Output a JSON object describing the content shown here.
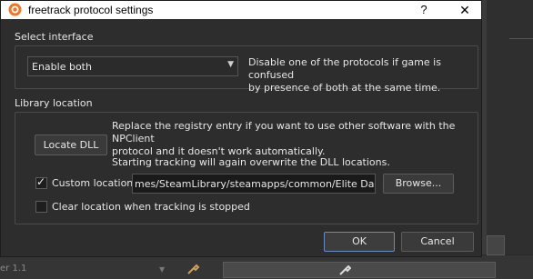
{
  "window": {
    "title": "freetrack protocol settings",
    "help_label": "?",
    "close_label": "✕"
  },
  "interface": {
    "group_label": "Select interface",
    "selected": "Enable both",
    "description_line1": "Disable one of the protocols if game is confused",
    "description_line2": "by presence of both at the same time."
  },
  "library": {
    "group_label": "Library location",
    "locate_button": "Locate DLL",
    "info_line1": "Replace the registry entry if you want to use other software with the NPClient",
    "info_line2": "protocol and it doesn't work automatically.",
    "info_line3": "Starting tracking will again overwrite the DLL locations.",
    "custom_location_label": "Custom location",
    "custom_location_checked": true,
    "path_value": "mes/SteamLibrary/steamapps/common/Elite Dangerous",
    "browse_button": "Browse...",
    "clear_location_label": "Clear location when tracking is stopped",
    "clear_location_checked": false
  },
  "buttons": {
    "ok": "OK",
    "cancel": "Cancel"
  },
  "background": {
    "version_fragment": "er 1.1"
  },
  "colors": {
    "dialog_bg": "#2d2d2d",
    "titlebar_bg": "#ffffff",
    "ok_focus_border": "#6a8bbf",
    "app_icon": "#e8772e"
  }
}
